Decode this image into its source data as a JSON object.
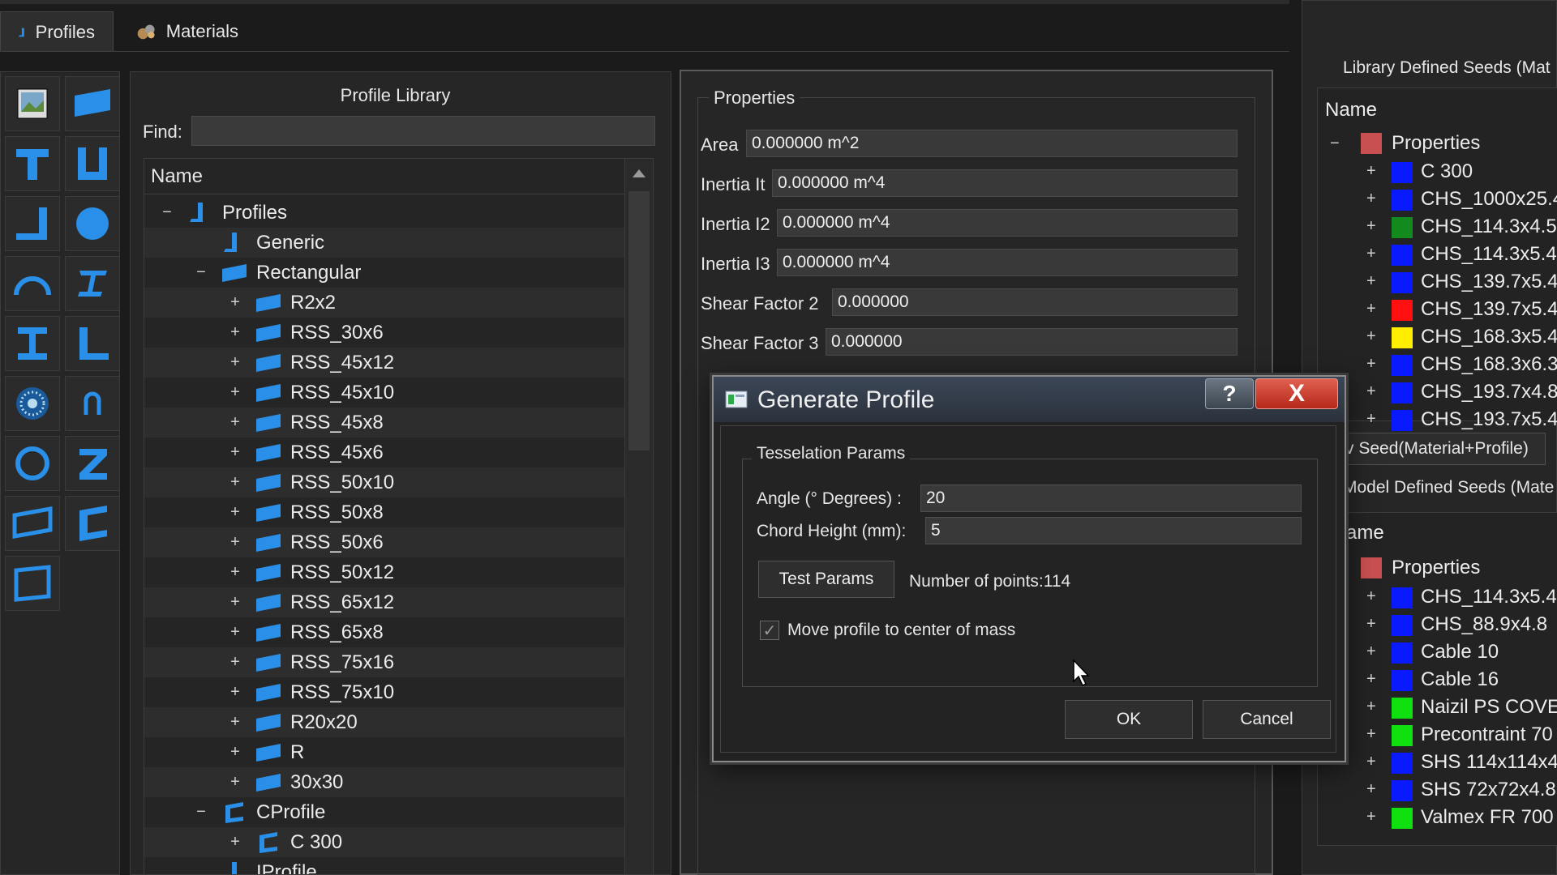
{
  "tabs": [
    {
      "label": "Profiles",
      "icon": "profile-icon"
    },
    {
      "label": "Materials",
      "icon": "materials-icon"
    }
  ],
  "library": {
    "title": "Profile Library",
    "find_label": "Find:",
    "find_value": "",
    "column_header": "Name",
    "rows": [
      {
        "toggle": "−",
        "label": "Profiles"
      },
      {
        "toggle": "",
        "label": "Generic"
      },
      {
        "toggle": "−",
        "label": "Rectangular"
      },
      {
        "toggle": "+",
        "label": "R2x2"
      },
      {
        "toggle": "+",
        "label": "RSS_30x6"
      },
      {
        "toggle": "+",
        "label": "RSS_45x12"
      },
      {
        "toggle": "+",
        "label": "RSS_45x10"
      },
      {
        "toggle": "+",
        "label": "RSS_45x8"
      },
      {
        "toggle": "+",
        "label": "RSS_45x6"
      },
      {
        "toggle": "+",
        "label": "RSS_50x10"
      },
      {
        "toggle": "+",
        "label": "RSS_50x8"
      },
      {
        "toggle": "+",
        "label": "RSS_50x6"
      },
      {
        "toggle": "+",
        "label": "RSS_50x12"
      },
      {
        "toggle": "+",
        "label": "RSS_65x12"
      },
      {
        "toggle": "+",
        "label": "RSS_65x8"
      },
      {
        "toggle": "+",
        "label": "RSS_75x16"
      },
      {
        "toggle": "+",
        "label": "RSS_75x10"
      },
      {
        "toggle": "+",
        "label": "R20x20"
      },
      {
        "toggle": "+",
        "label": "R"
      },
      {
        "toggle": "+",
        "label": "30x30"
      },
      {
        "toggle": "−",
        "label": "CProfile"
      },
      {
        "toggle": "+",
        "label": "C 300"
      },
      {
        "toggle": "",
        "label": "IProfile"
      }
    ]
  },
  "properties": {
    "legend": "Properties",
    "fields": [
      {
        "label": "Area",
        "value": "0.000000 m^2"
      },
      {
        "label": "Inertia It",
        "value": "0.000000 m^4"
      },
      {
        "label": "Inertia I2",
        "value": "0.000000 m^4"
      },
      {
        "label": "Inertia I3",
        "value": "0.000000 m^4"
      },
      {
        "label": "Shear Factor  2",
        "value": "0.000000"
      },
      {
        "label": "Shear Factor 3",
        "value": "0.000000"
      }
    ]
  },
  "library_seeds": {
    "title": "Library Defined Seeds (Mat",
    "header": "Name",
    "root": "Properties",
    "items": [
      {
        "label": "C 300",
        "color": "#0a1aff"
      },
      {
        "label": "CHS_1000x25.4",
        "color": "#0a1aff"
      },
      {
        "label": "CHS_114.3x4.5",
        "color": "#138a1d"
      },
      {
        "label": "CHS_114.3x5.4",
        "color": "#0a1aff"
      },
      {
        "label": "CHS_139.7x5.4",
        "color": "#0a1aff"
      },
      {
        "label": "CHS_139.7x5.4",
        "color": "#ff1010"
      },
      {
        "label": "CHS_168.3x5.4",
        "color": "#ffee00"
      },
      {
        "label": "CHS_168.3x6.3",
        "color": "#0a1aff"
      },
      {
        "label": "CHS_193.7x4.8",
        "color": "#0a1aff"
      },
      {
        "label": "CHS_193.7x5.4",
        "color": "#0a1aff"
      }
    ],
    "new_seed_button": "v Seed(Material+Profile)"
  },
  "model_seeds": {
    "title": "Model Defined Seeds (Mate",
    "header": "ame",
    "root": "Properties",
    "items": [
      {
        "label": "CHS_114.3x5.4",
        "color": "#0a1aff"
      },
      {
        "label": "CHS_88.9x4.8",
        "color": "#0a1aff"
      },
      {
        "label": "Cable 10",
        "color": "#0a1aff"
      },
      {
        "label": "Cable 16",
        "color": "#0a1aff"
      },
      {
        "label": "Naizil PS COVE",
        "color": "#10e010"
      },
      {
        "label": "Precontraint 70",
        "color": "#10e010"
      },
      {
        "label": "SHS 114x114x4",
        "color": "#0a1aff"
      },
      {
        "label": "SHS 72x72x4.8",
        "color": "#0a1aff"
      },
      {
        "label": "Valmex FR 700",
        "color": "#10e010"
      }
    ]
  },
  "dialog": {
    "title": "Generate Profile",
    "help": "?",
    "close": "X",
    "group_label": "Tesselation Params",
    "angle_label": "Angle (° Degrees) :",
    "angle_value": "20",
    "chord_label": "Chord Height (mm):",
    "chord_value": "5",
    "test_button": "Test Params",
    "points_text": "Number of points:114",
    "checkbox_label": "Move profile to center of mass",
    "checkbox_checked": true,
    "ok": "OK",
    "cancel": "Cancel"
  },
  "colors": {
    "accent": "#2a8fe8",
    "background": "#1b1b1b"
  }
}
